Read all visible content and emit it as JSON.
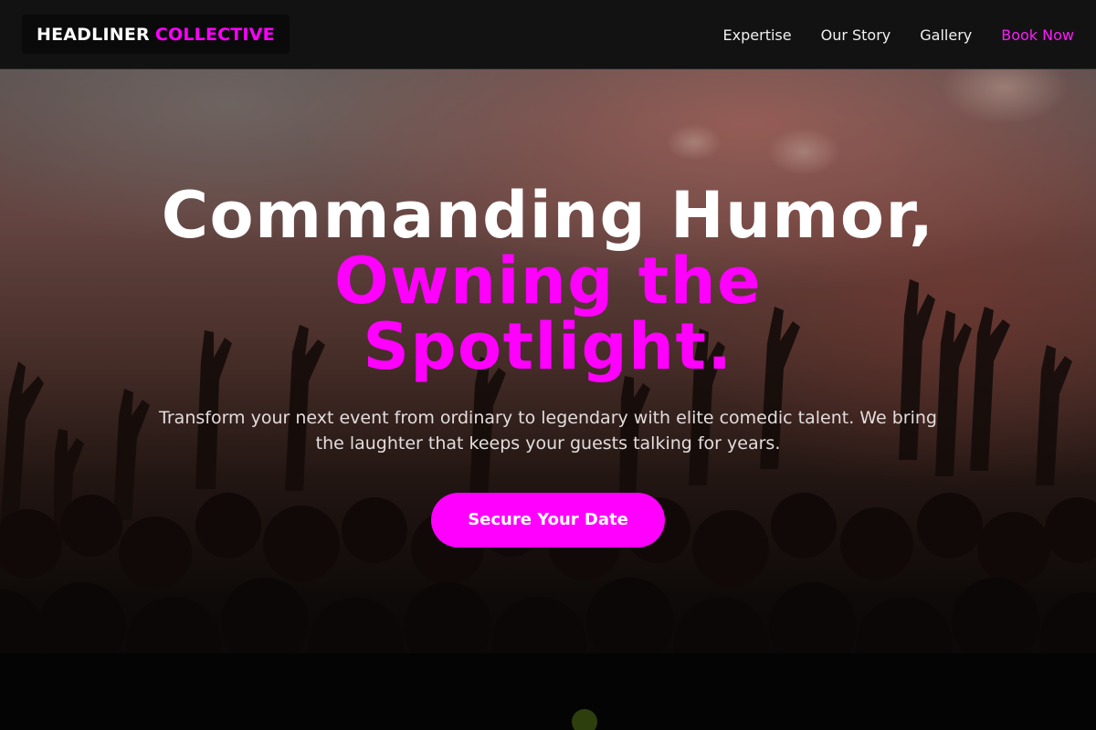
{
  "header": {
    "logo_primary": "HEADLINER",
    "logo_accent": "COLLECTIVE",
    "nav": [
      {
        "label": "Expertise"
      },
      {
        "label": "Our Story"
      },
      {
        "label": "Gallery"
      },
      {
        "label": "Book Now"
      }
    ]
  },
  "hero": {
    "headline_line1": "Commanding Humor,",
    "headline_line2": "Owning the",
    "headline_line3": "Spotlight.",
    "subtext": "Transform your next event from ordinary to legendary with elite comedic talent. We bring the laughter that keeps your guests talking for years.",
    "cta_label": "Secure Your Date"
  },
  "colors": {
    "accent": "#ff00ff",
    "header_bg": "#121212",
    "text": "#ffffff"
  }
}
